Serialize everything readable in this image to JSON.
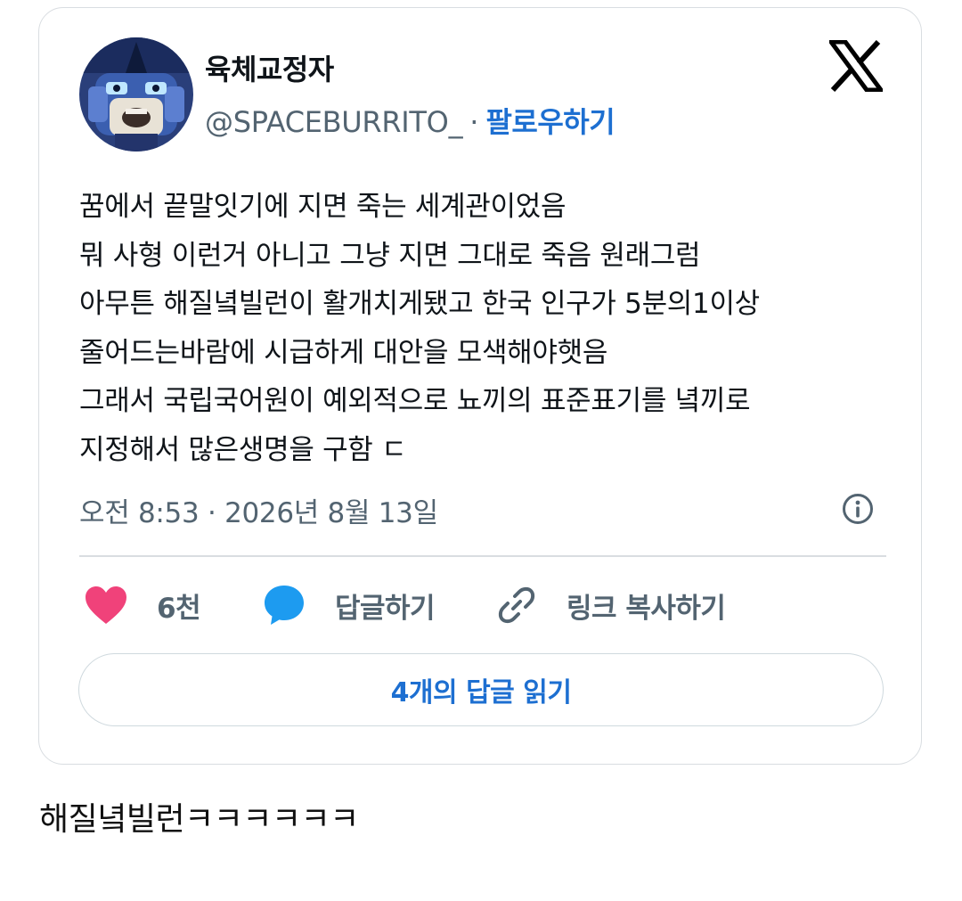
{
  "tweet": {
    "display_name": "육체교정자",
    "handle": "@SPACEBURRITO_",
    "separator": "·",
    "follow_label": "팔로우하기",
    "text_lines": [
      "꿈에서 끝말잇기에 지면 죽는 세계관이었음",
      "뭐 사형 이런거 아니고 그냥 지면 그대로 죽음 원래그럼",
      "아무튼 해질녘빌런이 활개치게됐고 한국 인구가 5분의1이상",
      "줄어드는바람에 시급하게 대안을 모색해야햇음",
      "그래서 국립국어원이 예외적으로 뇨끼의 표준표기를  녘끼로",
      "지정해서 많은생명을 구함 ㄷ"
    ],
    "timestamp": "오전 8:53 · 2026년 8월 13일",
    "like_count": "6천",
    "reply_label": "답글하기",
    "copy_link_label": "링크 복사하기",
    "read_replies_label": "4개의 답글 읽기"
  },
  "comment": "해질녘빌런ㅋㅋㅋㅋㅋㅋ",
  "icons": {
    "x_logo": "x-logo-icon",
    "info": "info-icon",
    "like": "heart-icon",
    "reply": "speech-bubble-icon",
    "copy": "link-icon"
  },
  "colors": {
    "heart": "#f0427a",
    "reply_bubble": "#1d9bf0",
    "link_accent": "#1d6fd1",
    "muted_text": "#536471"
  }
}
